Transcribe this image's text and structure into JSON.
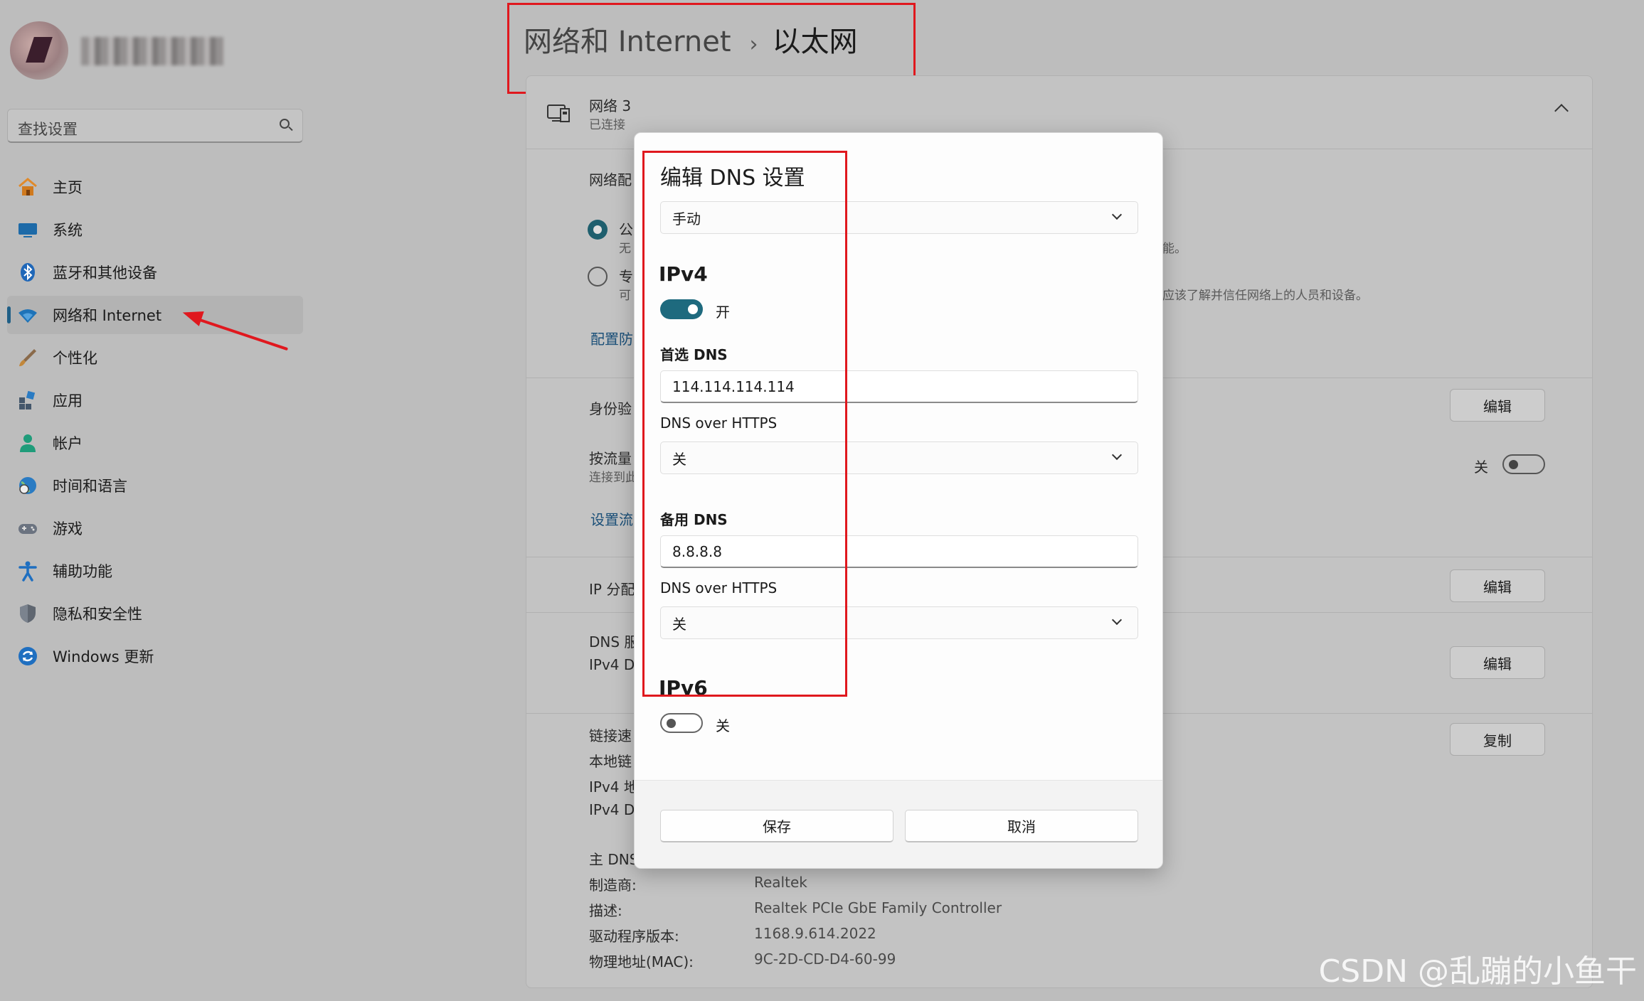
{
  "sidebar": {
    "search_placeholder": "查找设置",
    "items": [
      {
        "label": "主页"
      },
      {
        "label": "系统"
      },
      {
        "label": "蓝牙和其他设备"
      },
      {
        "label": "网络和 Internet"
      },
      {
        "label": "个性化"
      },
      {
        "label": "应用"
      },
      {
        "label": "帐户"
      },
      {
        "label": "时间和语言"
      },
      {
        "label": "游戏"
      },
      {
        "label": "辅助功能"
      },
      {
        "label": "隐私和安全性"
      },
      {
        "label": "Windows 更新"
      }
    ]
  },
  "header": {
    "breadcrumb_parent": "网络和 Internet",
    "breadcrumb_sep": "›",
    "breadcrumb_current": "以太网"
  },
  "network": {
    "name": "网络 3",
    "status": "已连接",
    "profile_label": "网络配",
    "public_label": "公",
    "public_desc": "无",
    "public_desc_tail": "能。",
    "private_label": "专",
    "private_desc": "可",
    "private_desc_tail": "应该了解并信任网络上的人员和设备。",
    "firewall_link": "配置防",
    "auth_label": "身份验",
    "edit_btn_1": "编辑",
    "metered_label": "按流量",
    "metered_sub": "连接到此",
    "metered_toggle_label": "关",
    "data_limit_link": "设置流",
    "ip_assign_label": "IP 分配",
    "edit_btn_2": "编辑",
    "dns_label": "DNS 服",
    "dns_sub": "IPv4 DI",
    "edit_btn_3": "编辑",
    "link_speed": "链接速",
    "local_link": "本地链",
    "ipv4_addr": "IPv4 地",
    "ipv4_dns": "IPv4 DI",
    "copy_btn": "复制",
    "primary_dns": "主 DNS",
    "manufacturer_label": "制造商:",
    "manufacturer_value": "Realtek",
    "description_label": "描述:",
    "description_value": "Realtek PCIe GbE Family Controller",
    "driver_label": "驱动程序版本:",
    "driver_value": "1168.9.614.2022",
    "mac_label": "物理地址(MAC):",
    "mac_value": "9C-2D-CD-D4-60-99"
  },
  "dialog": {
    "title": "编辑 DNS 设置",
    "mode_value": "手动",
    "ipv4_title": "IPv4",
    "ipv4_toggle_label": "开",
    "ipv4_enabled": true,
    "preferred_dns_label": "首选 DNS",
    "preferred_dns_value": "114.114.114.114",
    "doh_label_1": "DNS over HTTPS",
    "doh_value_1": "关",
    "alternate_dns_label": "备用 DNS",
    "alternate_dns_value": "8.8.8.8",
    "doh_label_2": "DNS over HTTPS",
    "doh_value_2": "关",
    "ipv6_title": "IPv6",
    "ipv6_toggle_label": "关",
    "ipv6_enabled": false,
    "save_label": "保存",
    "cancel_label": "取消"
  },
  "watermark": "CSDN @乱蹦的小鱼干",
  "colors": {
    "accent": "#1e6a7e",
    "annotation_red": "#e0181e",
    "overlay_bg": "#bdbdbd"
  }
}
